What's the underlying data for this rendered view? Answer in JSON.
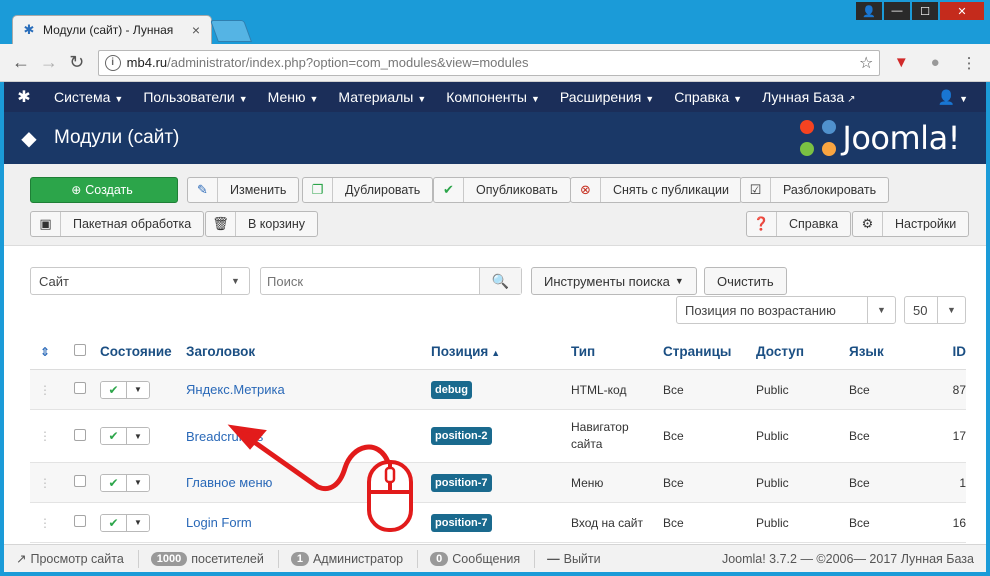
{
  "browser": {
    "tab_title": "Модули (сайт) - Лунная",
    "url_host": "mb4.ru",
    "url_path": "/administrator/index.php?option=com_modules&view=modules"
  },
  "nav": {
    "items": [
      {
        "label": "Система"
      },
      {
        "label": "Пользователи"
      },
      {
        "label": "Меню"
      },
      {
        "label": "Материалы"
      },
      {
        "label": "Компоненты"
      },
      {
        "label": "Расширения"
      },
      {
        "label": "Справка"
      }
    ],
    "site_link": "Лунная База"
  },
  "header": {
    "page_title": "Модули (сайт)",
    "brand": "Joomla!"
  },
  "toolbar": {
    "create": "Создать",
    "edit": "Изменить",
    "duplicate": "Дублировать",
    "publish": "Опубликовать",
    "unpublish": "Снять с публикации",
    "unlock": "Разблокировать",
    "batch": "Пакетная обработка",
    "trash": "В корзину",
    "help": "Справка",
    "options": "Настройки"
  },
  "filters": {
    "client": "Сайт",
    "search_placeholder": "Поиск",
    "search_tools": "Инструменты поиска",
    "clear": "Очистить",
    "ordering": "Позиция по возрастанию",
    "limit": "50"
  },
  "table": {
    "headers": {
      "state": "Состояние",
      "title": "Заголовок",
      "position": "Позиция",
      "type": "Тип",
      "pages": "Страницы",
      "access": "Доступ",
      "language": "Язык",
      "id": "ID"
    },
    "rows": [
      {
        "title": "Яндекс.Метрика",
        "position": "debug",
        "type": "HTML-код",
        "pages": "Все",
        "access": "Public",
        "language": "Все",
        "id": "87"
      },
      {
        "title": "Breadcrumbs",
        "position": "position-2",
        "type": "Навигатор сайта",
        "pages": "Все",
        "access": "Public",
        "language": "Все",
        "id": "17"
      },
      {
        "title": "Главное меню",
        "position": "position-7",
        "type": "Меню",
        "pages": "Все",
        "access": "Public",
        "language": "Все",
        "id": "1"
      },
      {
        "title": "Login Form",
        "position": "position-7",
        "type": "Вход на сайт",
        "pages": "Все",
        "access": "Public",
        "language": "Все",
        "id": "16"
      }
    ]
  },
  "status": {
    "view_site": "Просмотр сайта",
    "visitors_count": "1000",
    "visitors_label": "посетителей",
    "admins_count": "1",
    "admins_label": "Администратор",
    "messages_count": "0",
    "messages_label": "Сообщения",
    "logout": "Выйти",
    "copyright": "Joomla! 3.7.2 — ©2006— 2017 Лунная База"
  },
  "colors": {
    "nav_bg": "#1b2e59",
    "header_bg": "#1a3867",
    "create_green": "#2ca54a",
    "link_blue": "#2a69b8",
    "badge_teal": "#1a6a8e",
    "annotation_red": "#e21b1b"
  }
}
